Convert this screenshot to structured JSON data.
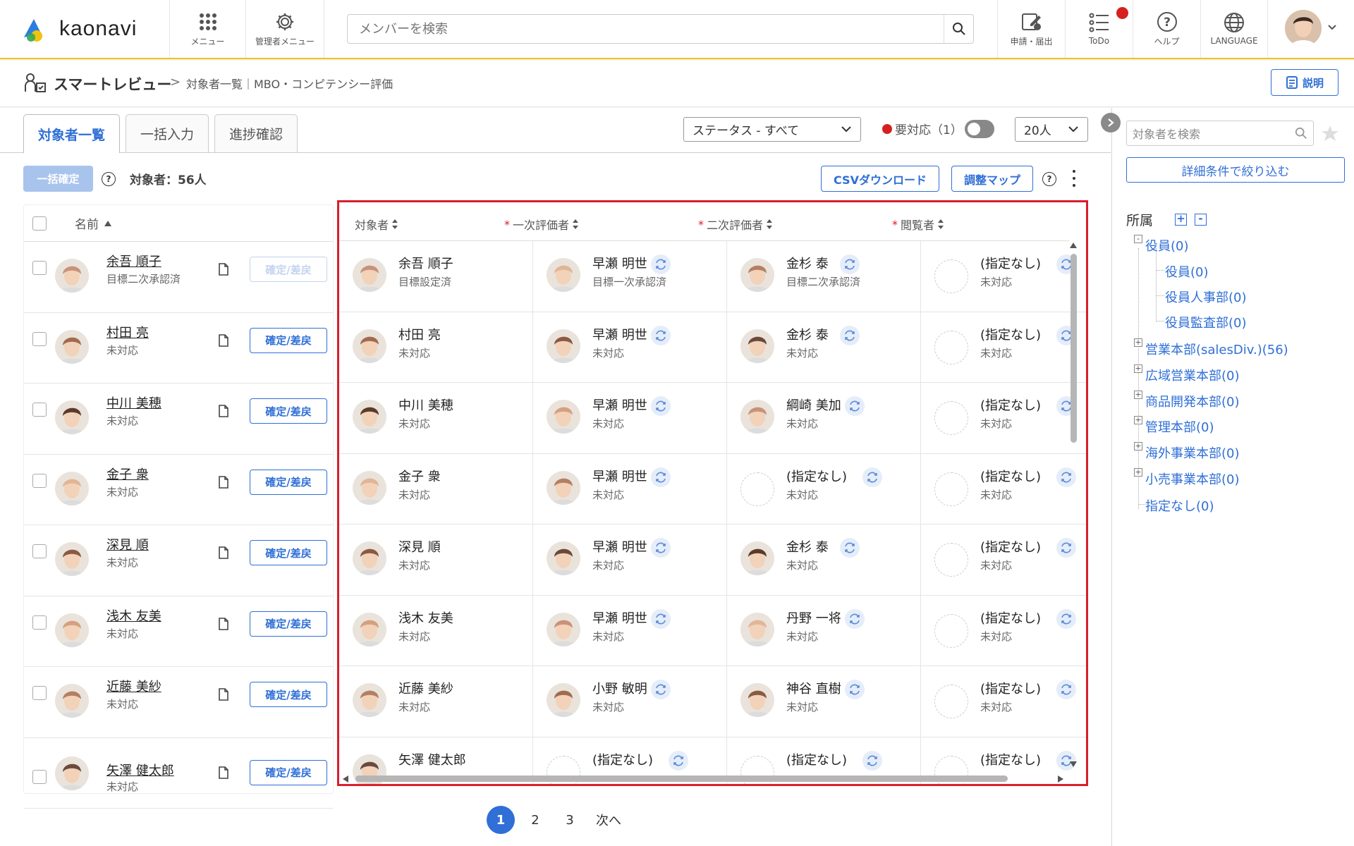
{
  "header": {
    "logo": "kaonavi",
    "menu": "メニュー",
    "admin_menu": "管理者メニュー",
    "search_placeholder": "メンバーを検索",
    "apply": "申請・届出",
    "todo": "ToDo",
    "help": "ヘルプ",
    "language": "LANGUAGE"
  },
  "breadcrumb": {
    "title": "スマートレビュー",
    "sep": ">",
    "sub": "対象者一覧｜MBO・コンピテンシー評価",
    "explain": "説明"
  },
  "tabs": [
    "対象者一覧",
    "一括入力",
    "進捗確認"
  ],
  "filters": {
    "status": "ステータス - すべて",
    "required": "要対応（1）",
    "page_size": "20人"
  },
  "toolbar": {
    "bulk_confirm": "一括確定",
    "targets": "対象者：56人",
    "csv": "CSVダウンロード",
    "adjust_map": "調整マップ"
  },
  "left_table": {
    "name_header": "名前",
    "confirm_label": "確定/差戻"
  },
  "columns": [
    {
      "label": "対象者",
      "required": ""
    },
    {
      "label": "一次評価者",
      "required": "*"
    },
    {
      "label": "二次評価者",
      "required": "*"
    },
    {
      "label": "閲覧者",
      "required": "*"
    }
  ],
  "rows": [
    {
      "name": "余吾 順子",
      "status": "目標二次承認済",
      "confirm_disabled": true,
      "cells": [
        {
          "name": "余吾 順子",
          "status": "目標設定済"
        },
        {
          "name": "早瀬 明世",
          "status": "目標一次承認済"
        },
        {
          "name": "金杉 泰",
          "status": "目標二次承認済"
        },
        {
          "name": "(指定なし)",
          "status": "未対応"
        }
      ]
    },
    {
      "name": "村田 亮",
      "status": "未対応",
      "cells": [
        {
          "name": "村田 亮",
          "status": "未対応"
        },
        {
          "name": "早瀬 明世",
          "status": "未対応"
        },
        {
          "name": "金杉 泰",
          "status": "未対応"
        },
        {
          "name": "(指定なし)",
          "status": "未対応"
        }
      ]
    },
    {
      "name": "中川 美穂",
      "status": "未対応",
      "cells": [
        {
          "name": "中川 美穂",
          "status": "未対応"
        },
        {
          "name": "早瀬 明世",
          "status": "未対応"
        },
        {
          "name": "綱崎 美加",
          "status": "未対応"
        },
        {
          "name": "(指定なし)",
          "status": "未対応"
        }
      ]
    },
    {
      "name": "金子 衆",
      "status": "未対応",
      "cells": [
        {
          "name": "金子 衆",
          "status": "未対応"
        },
        {
          "name": "早瀬 明世",
          "status": "未対応"
        },
        {
          "name": "(指定なし)",
          "status": "未対応"
        },
        {
          "name": "(指定なし)",
          "status": "未対応"
        }
      ]
    },
    {
      "name": "深見 順",
      "status": "未対応",
      "cells": [
        {
          "name": "深見 順",
          "status": "未対応"
        },
        {
          "name": "早瀬 明世",
          "status": "未対応"
        },
        {
          "name": "金杉 泰",
          "status": "未対応"
        },
        {
          "name": "(指定なし)",
          "status": "未対応"
        }
      ]
    },
    {
      "name": "浅木 友美",
      "status": "未対応",
      "cells": [
        {
          "name": "浅木 友美",
          "status": "未対応"
        },
        {
          "name": "早瀬 明世",
          "status": "未対応"
        },
        {
          "name": "丹野 一将",
          "status": "未対応"
        },
        {
          "name": "(指定なし)",
          "status": "未対応"
        }
      ]
    },
    {
      "name": "近藤 美紗",
      "status": "未対応",
      "cells": [
        {
          "name": "近藤 美紗",
          "status": "未対応"
        },
        {
          "name": "小野 敏明",
          "status": "未対応"
        },
        {
          "name": "神谷 直樹",
          "status": "未対応"
        },
        {
          "name": "(指定なし)",
          "status": "未対応"
        }
      ]
    },
    {
      "name": "矢澤 健太郎",
      "status": "未対応",
      "cells": [
        {
          "name": "矢澤 健太郎",
          "status": ""
        },
        {
          "name": "(指定なし)",
          "status": ""
        },
        {
          "name": "(指定なし)",
          "status": ""
        },
        {
          "name": "(指定なし)",
          "status": ""
        }
      ]
    }
  ],
  "pagination": [
    "1",
    "2",
    "3",
    "次へ"
  ],
  "sidebar": {
    "search_placeholder": "対象者を検索",
    "filter_button": "詳細条件で絞り込む",
    "dept_label": "所属",
    "tree": [
      {
        "label": "役員(0)",
        "level": 0,
        "expandable": true
      },
      {
        "label": "役員(0)",
        "level": 1
      },
      {
        "label": "役員人事部(0)",
        "level": 1
      },
      {
        "label": "役員監査部(0)",
        "level": 1
      },
      {
        "label": "営業本部(salesDiv.)(56)",
        "level": 0,
        "expandable": true
      },
      {
        "label": "広域営業本部(0)",
        "level": 0,
        "expandable": true
      },
      {
        "label": "商品開発本部(0)",
        "level": 0,
        "expandable": true
      },
      {
        "label": "管理本部(0)",
        "level": 0,
        "expandable": true
      },
      {
        "label": "海外事業本部(0)",
        "level": 0,
        "expandable": true
      },
      {
        "label": "小売事業本部(0)",
        "level": 0,
        "expandable": true
      },
      {
        "label": "指定なし(0)",
        "level": 0
      }
    ]
  },
  "colors": {
    "accent": "#2f6fd6",
    "highlight": "#d91e2c",
    "notify": "#d62020"
  }
}
